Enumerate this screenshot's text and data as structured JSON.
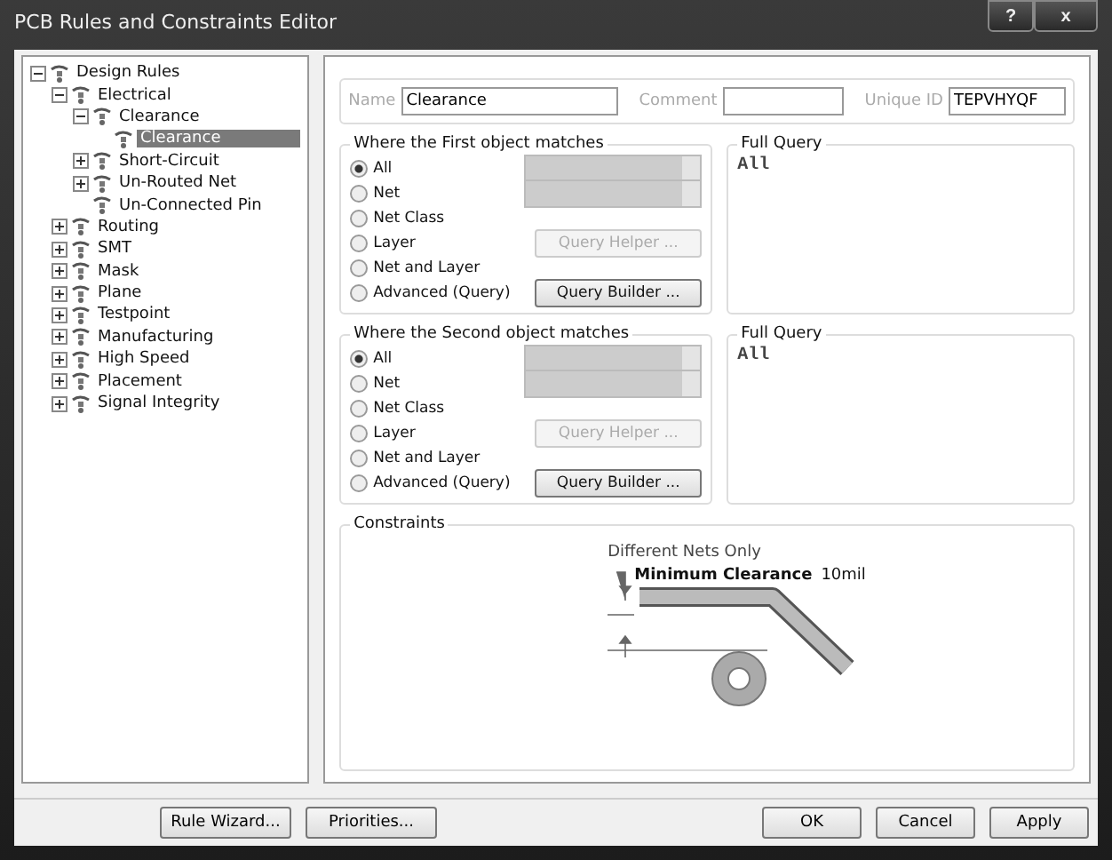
{
  "window": {
    "title": "PCB Rules and Constraints Editor",
    "help": "?",
    "close": "x"
  },
  "tree": [
    {
      "label": "Design Rules",
      "expanded": true,
      "selected": false,
      "children": [
        {
          "label": "Electrical",
          "expanded": true,
          "selected": false,
          "children": [
            {
              "label": "Clearance",
              "expanded": true,
              "selected": false,
              "children": [
                {
                  "label": "Clearance",
                  "selected": true
                }
              ]
            },
            {
              "label": "Short-Circuit",
              "expanded": false,
              "selected": false
            },
            {
              "label": "Un-Routed Net",
              "expanded": false,
              "selected": false
            },
            {
              "label": "Un-Connected Pin",
              "selected": false
            }
          ]
        },
        {
          "label": "Routing",
          "expanded": false,
          "selected": false
        },
        {
          "label": "SMT",
          "expanded": false,
          "selected": false
        },
        {
          "label": "Mask",
          "expanded": false,
          "selected": false
        },
        {
          "label": "Plane",
          "expanded": false,
          "selected": false
        },
        {
          "label": "Testpoint",
          "expanded": false,
          "selected": false
        },
        {
          "label": "Manufacturing",
          "expanded": false,
          "selected": false
        },
        {
          "label": "High Speed",
          "expanded": false,
          "selected": false
        },
        {
          "label": "Placement",
          "expanded": false,
          "selected": false
        },
        {
          "label": "Signal Integrity",
          "expanded": false,
          "selected": false
        }
      ]
    }
  ],
  "rule": {
    "name_label": "Name",
    "name": "Clearance",
    "comment_label": "Comment",
    "unique_id_label": "Unique ID",
    "unique_id": "TEPVHYQF"
  },
  "matches": [
    {
      "title": "Where the First object matches",
      "options": [
        {
          "label": "All",
          "selected": true
        },
        {
          "label": "Net",
          "selected": false
        },
        {
          "label": "Net Class",
          "selected": false
        },
        {
          "label": "Layer",
          "selected": false
        },
        {
          "label": "Net and Layer",
          "selected": false
        },
        {
          "label": "Advanced (Query)",
          "selected": false
        }
      ],
      "query_helper": {
        "label": "Query Helper ...",
        "disabled": true
      },
      "query_builder": {
        "label": "Query Builder ...",
        "disabled": false
      },
      "full_query_title": "Full Query",
      "full_query": "All"
    },
    {
      "title": "Where the Second object matches",
      "options": [
        {
          "label": "All",
          "selected": true
        },
        {
          "label": "Net",
          "selected": false
        },
        {
          "label": "Net Class",
          "selected": false
        },
        {
          "label": "Layer",
          "selected": false
        },
        {
          "label": "Net and Layer",
          "selected": false
        },
        {
          "label": "Advanced (Query)",
          "selected": false
        }
      ],
      "query_helper": {
        "label": "Query Helper ...",
        "disabled": true
      },
      "query_builder": {
        "label": "Query Builder ...",
        "disabled": false
      },
      "full_query_title": "Full Query",
      "full_query": "All"
    }
  ],
  "constraints": {
    "title": "Constraints",
    "scope": "Different Nets Only",
    "label": "Minimum Clearance",
    "value": "10mil"
  },
  "footer": {
    "left": [
      "Rule Wizard...",
      "Priorities..."
    ],
    "right": [
      "OK",
      "Cancel",
      "Apply"
    ]
  }
}
